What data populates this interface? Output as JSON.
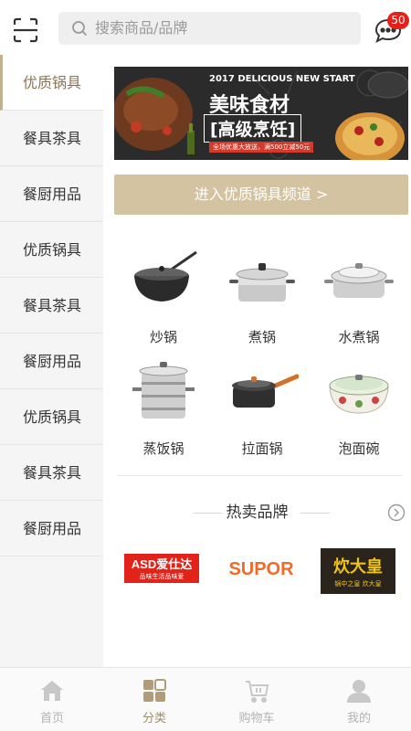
{
  "header": {
    "search_placeholder": "搜索商品/品牌",
    "message_badge": "50"
  },
  "sidebar": {
    "items": [
      {
        "label": "优质锅具",
        "active": true
      },
      {
        "label": "餐具茶具"
      },
      {
        "label": "餐厨用品"
      },
      {
        "label": "优质锅具"
      },
      {
        "label": "餐具茶具"
      },
      {
        "label": "餐厨用品"
      },
      {
        "label": "优质锅具"
      },
      {
        "label": "餐具茶具"
      },
      {
        "label": "餐厨用品"
      }
    ]
  },
  "banner": {
    "line1": "2017 DELICIOUS NEW START",
    "line2": "美味食材",
    "line3": "[高级烹饪]",
    "line4": "全场优惠大放送，满500立减50元"
  },
  "channel_button": "进入优质锅具频道 >",
  "products": [
    {
      "name": "炒锅",
      "icon": "wok-icon"
    },
    {
      "name": "煮锅",
      "icon": "stockpot-icon"
    },
    {
      "name": "水煮锅",
      "icon": "boiling-pot-icon"
    },
    {
      "name": "蒸饭锅",
      "icon": "steamer-icon"
    },
    {
      "name": "拉面锅",
      "icon": "noodle-pot-icon"
    },
    {
      "name": "泡面碗",
      "icon": "noodle-bowl-icon"
    }
  ],
  "hot_brands": {
    "title": "热卖品牌",
    "brands": [
      {
        "logo_text": "ASD爱仕达",
        "tagline": "品味生活品味爱",
        "color": "#e2231a"
      },
      {
        "logo_text": "SUPOR",
        "color": "#f26a2a"
      },
      {
        "logo_text": "炊大皇",
        "tagline": "锅中之皇 炊大皇",
        "color": "#2a241c"
      }
    ]
  },
  "tabbar": {
    "tabs": [
      {
        "label": "首页",
        "icon": "home-icon"
      },
      {
        "label": "分类",
        "icon": "category-icon",
        "active": true
      },
      {
        "label": "购物车",
        "icon": "cart-icon"
      },
      {
        "label": "我的",
        "icon": "profile-icon"
      }
    ]
  },
  "colors": {
    "accent": "#c3b08f",
    "button": "#d4c3a1",
    "active_text": "#8a7556",
    "badge": "#e61f19"
  }
}
